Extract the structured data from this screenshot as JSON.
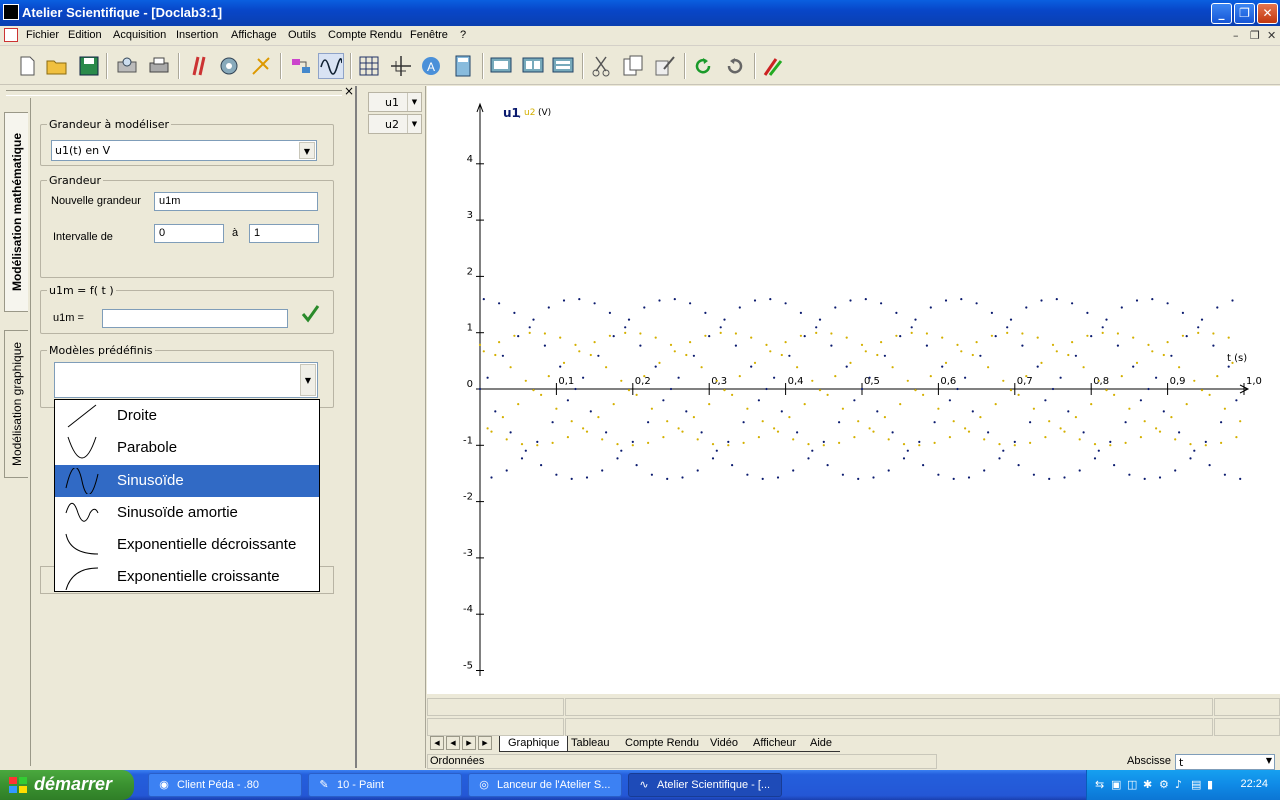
{
  "window": {
    "title": "Atelier Scientifique - [Doclab3:1]"
  },
  "menu": [
    "Fichier",
    "Edition",
    "Acquisition",
    "Insertion",
    "Affichage",
    "Outils",
    "Compte Rendu",
    "Fenêtre",
    "?"
  ],
  "toolbar_icons": [
    "new-doc-icon",
    "open-folder-icon",
    "save-icon",
    "print-preview-icon",
    "print-icon",
    "acquisition-icon",
    "sensor-icon",
    "tools-icon",
    "model-icon",
    "curve-icon",
    "grid-icon",
    "crosshair-icon",
    "calculator-icon",
    "table-icon",
    "screen1-icon",
    "screen2-icon",
    "screen3-icon",
    "cut-icon",
    "paste-icon",
    "magic-icon",
    "undo-icon",
    "redo-icon",
    "report-icon"
  ],
  "side_tabs": {
    "math": "Modélisation mathématique",
    "graph": "Modélisation graphique"
  },
  "model": {
    "grandeur_legend": "Grandeur à modéliser",
    "grandeur_value": "u1(t) en V",
    "grandeur2_legend": "Grandeur",
    "nouvelle_label": "Nouvelle grandeur",
    "nouvelle_value": "u1m",
    "intervalle_label": "Intervalle de",
    "intervalle_from": "0",
    "a_label": "à",
    "intervalle_to": "1",
    "equation_legend": "u1m = f( t )",
    "equation_label": "u1m =",
    "equation_value": "",
    "predef_legend": "Modèles prédéfinis",
    "predef_value": ""
  },
  "popup_items": [
    "Droite",
    "Parabole",
    "Sinusoïde",
    "Sinusoïde amortie",
    "Exponentielle décroissante",
    "Exponentielle croissante"
  ],
  "popup_selected": "Sinusoïde",
  "series_selectors": [
    "u1",
    "u2"
  ],
  "graph": {
    "legend_u1": "u1",
    "legend_sep": ",",
    "legend_u2": "u2",
    "legend_unit": "(V)",
    "xlabel": "t (s)",
    "u1_color": "#0a1a6e",
    "u2_color": "#d4b000"
  },
  "chart_data": {
    "type": "scatter",
    "xlim": [
      0,
      1.0
    ],
    "ylim": [
      -5,
      4
    ],
    "x_ticks": [
      "0,1",
      "0,2",
      "0,3",
      "0,4",
      "0,5",
      "0,6",
      "0,7",
      "0,8",
      "0,9",
      "1,0"
    ],
    "y_ticks": [
      "4",
      "3",
      "2",
      "1",
      "0",
      "-1",
      "-2",
      "-3",
      "-4",
      "-5"
    ],
    "series": [
      {
        "name": "u1",
        "color": "#0a1a6e",
        "amplitude": 1.6,
        "frequency_hz": 48,
        "n_points": 200
      },
      {
        "name": "u2",
        "color": "#d4b000",
        "amplitude": 1.0,
        "frequency_hz": 48,
        "n_points": 200
      }
    ]
  },
  "bottom_tabs": [
    "Graphique",
    "Tableau",
    "Compte Rendu",
    "Vidéo",
    "Afficheur",
    "Aide"
  ],
  "bottom_active": "Graphique",
  "ordonnees_label": "Ordonnées",
  "abscisse_label": "Abscisse",
  "abscisse_value": "t",
  "taskbar": {
    "start": "démarrer",
    "tasks": [
      "Client Péda - .80",
      "10 - Paint",
      "Lanceur de l'Atelier S...",
      "Atelier Scientifique - [..."
    ],
    "clock": "22:24"
  }
}
